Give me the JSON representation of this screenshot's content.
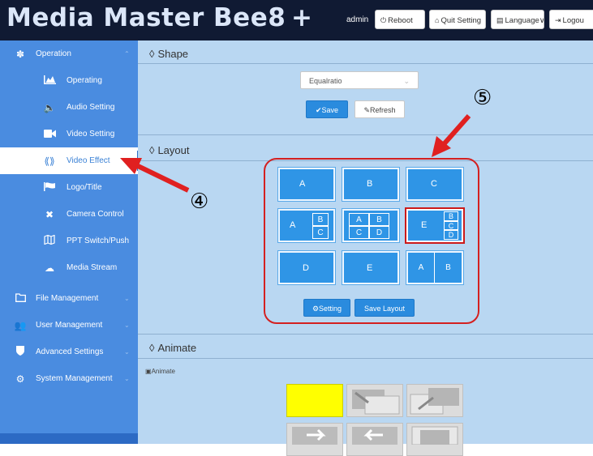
{
  "header": {
    "brand": "Media Master Bee8 +",
    "user": "admin",
    "buttons": [
      {
        "icon": "⏻",
        "label": "Reboot"
      },
      {
        "icon": "⌂",
        "label": "Quit Setting"
      },
      {
        "icon": "▤",
        "label": "Language∨"
      },
      {
        "icon": "⇥",
        "label": "Logou"
      }
    ]
  },
  "sidebar": {
    "items": [
      {
        "label": "Operation",
        "icon": "palette-icon"
      },
      {
        "label": "Operating",
        "icon": "area-chart-icon"
      },
      {
        "label": "Audio Setting",
        "icon": "speaker-icon"
      },
      {
        "label": "Video Setting",
        "icon": "video-camera-icon"
      },
      {
        "label": "Video Effect",
        "icon": "effect-icon"
      },
      {
        "label": "Logo/Title",
        "icon": "flag-icon"
      },
      {
        "label": "Camera Control",
        "icon": "camera-control-icon"
      },
      {
        "label": "PPT Switch/Push",
        "icon": "map-icon"
      },
      {
        "label": "Media Stream",
        "icon": "cloud-icon"
      },
      {
        "label": "File Management",
        "icon": "folder-icon"
      },
      {
        "label": "User Management",
        "icon": "users-icon"
      },
      {
        "label": "Advanced Settings",
        "icon": "shield-icon"
      },
      {
        "label": "System Management",
        "icon": "cogs-icon"
      }
    ]
  },
  "shape": {
    "title": "Shape",
    "select_value": "Equalratio",
    "save_label": "Save",
    "refresh_label": "Refresh"
  },
  "layout": {
    "title": "Layout",
    "tiles": [
      {
        "letters": [
          "A"
        ]
      },
      {
        "letters": [
          "B"
        ]
      },
      {
        "letters": [
          "C"
        ]
      },
      {
        "letters": [
          "A",
          "B",
          "C"
        ]
      },
      {
        "letters": [
          "A",
          "B",
          "C",
          "D"
        ]
      },
      {
        "letters": [
          "E",
          "B",
          "C",
          "D"
        ],
        "selected": true
      },
      {
        "letters": [
          "D"
        ]
      },
      {
        "letters": [
          "E"
        ]
      },
      {
        "letters": [
          "A",
          "B"
        ]
      }
    ],
    "setting_label": "Setting",
    "save_layout_label": "Save Layout"
  },
  "animate": {
    "title": "Animate",
    "sub_label": "Animate"
  },
  "callouts": {
    "four": "④",
    "five": "⑤"
  },
  "colors": {
    "header_bg": "#101a33",
    "sidebar_bg": "#4a8ce0",
    "main_bg": "#b9d7f2",
    "tile_blue": "#2f95e6",
    "selected_outline": "#cc1a1a",
    "annotation_red": "#e02020",
    "animate_selected": "#ffff00"
  }
}
